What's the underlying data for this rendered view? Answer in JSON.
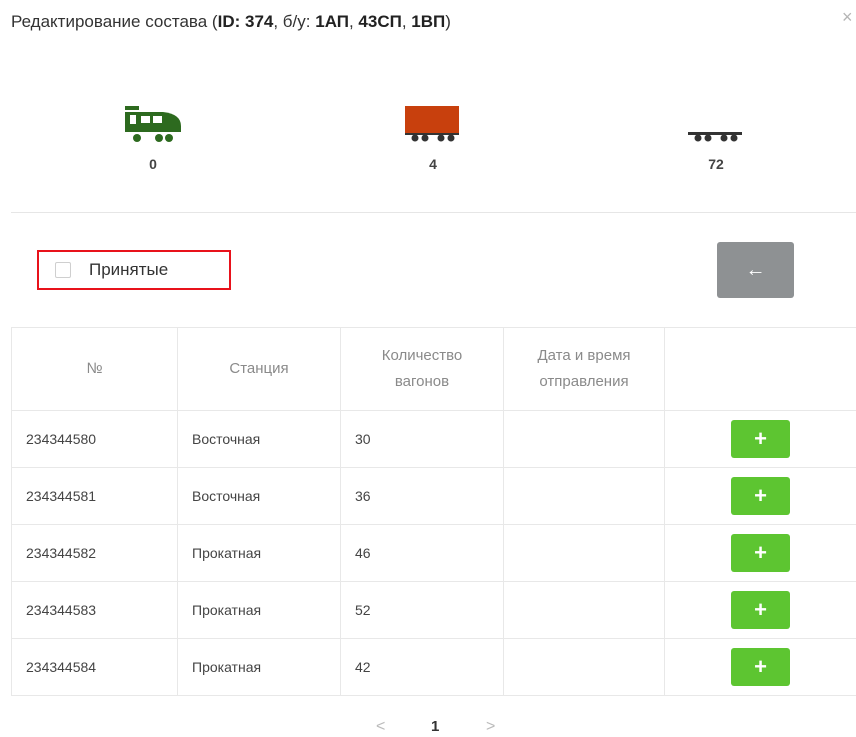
{
  "header": {
    "title_prefix": "Редактирование состава (",
    "title_id": "ID: 374",
    "title_mid": ", б/у: ",
    "c1_num": "1",
    "c1_label": "АП",
    "sep1": ", ",
    "c2_num": "43",
    "c2_label": "СП",
    "sep2": ", ",
    "c3_num": "1",
    "c3_label": "ВП",
    "title_suffix": ")",
    "close_icon": "×"
  },
  "stats": [
    {
      "icon": "locomotive-icon",
      "value": "0",
      "color": "#2d6a1f"
    },
    {
      "icon": "boxcar-icon",
      "value": "4",
      "color": "#c8400d"
    },
    {
      "icon": "flatcar-icon",
      "value": "72",
      "color": "#333333"
    }
  ],
  "filter": {
    "accepted_label": "Принятые",
    "checked": false
  },
  "back_button": {
    "icon": "arrow-left-icon",
    "glyph": "←"
  },
  "table": {
    "headers": [
      "№",
      "Станция",
      "Количество вагонов",
      "Дата и время отправления",
      ""
    ],
    "rows": [
      {
        "number": "234344580",
        "station": "Восточная",
        "wagons": "30",
        "datetime": ""
      },
      {
        "number": "234344581",
        "station": "Восточная",
        "wagons": "36",
        "datetime": ""
      },
      {
        "number": "234344582",
        "station": "Прокатная",
        "wagons": "46",
        "datetime": ""
      },
      {
        "number": "234344583",
        "station": "Прокатная",
        "wagons": "52",
        "datetime": ""
      },
      {
        "number": "234344584",
        "station": "Прокатная",
        "wagons": "42",
        "datetime": ""
      }
    ],
    "add_glyph": "+"
  },
  "pagination": {
    "prev": "<",
    "page": "1",
    "next": ">"
  },
  "colors": {
    "accent_green": "#5dc531",
    "highlight_red": "#e8121b",
    "back_button": "#8e9193"
  }
}
